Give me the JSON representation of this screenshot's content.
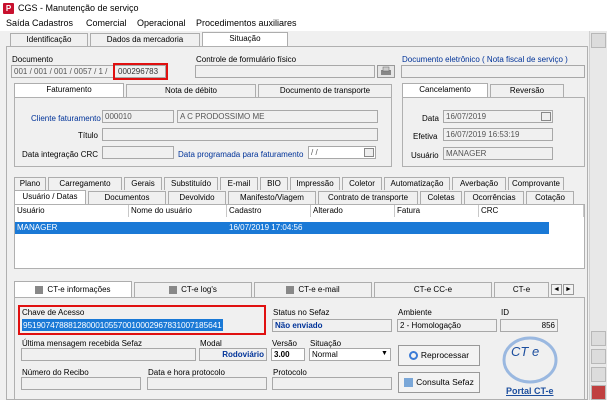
{
  "window": {
    "title": "CGS - Manutenção de serviço"
  },
  "menu": [
    "Saída",
    "Cadastros",
    "Comercial",
    "Operacional",
    "Procedimentos auxiliares"
  ],
  "top_tabs": [
    "Identificação",
    "Dados da mercadoria",
    "Situação"
  ],
  "documento": {
    "label": "Documento",
    "value": "001 / 001 / 001 / 0057 / 1 /",
    "number": "000296783"
  },
  "controle": {
    "label": "Controle de formulário físico"
  },
  "doc_eletronico": {
    "label": "Documento eletrônico ( Nota fiscal de serviço )"
  },
  "fat_tabs": [
    "Faturamento",
    "Nota de débito",
    "Documento de transporte"
  ],
  "cancel_tabs": [
    "Cancelamento",
    "Reversão"
  ],
  "fat": {
    "cliente_label": "Cliente faturamento",
    "cliente_code": "000010",
    "cliente_name": "A C PRODOSSIMO ME",
    "titulo_label": "Título",
    "integracao_label": "Data integração CRC",
    "programada_label": "Data programada para faturamento",
    "programada_value": "/ /"
  },
  "cancel": {
    "data_label": "Data",
    "data_value": "16/07/2019",
    "efetiva_label": "Efetiva",
    "efetiva_value": "16/07/2019 16:53:19",
    "usuario_label": "Usuário",
    "usuario_value": "MANAGER"
  },
  "sub_tabs_row1": [
    "Plano",
    "Carregamento",
    "Gerais",
    "Substituído",
    "E-mail",
    "BIO",
    "Impressão",
    "Coletor",
    "Automatização",
    "Averbação",
    "Comprovante"
  ],
  "sub_tabs_row2": [
    "Usuário / Datas",
    "Documentos",
    "Devolvido",
    "Manifesto/Viagem",
    "Contrato de transporte",
    "Coletas",
    "Ocorrências",
    "Cotação"
  ],
  "grid": {
    "headers": [
      "Usuário",
      "Nome do usuário",
      "Cadastro",
      "Alterado",
      "Fatura",
      "CRC"
    ],
    "row": [
      "MANAGER",
      "",
      "16/07/2019 17:04:56",
      "",
      "",
      ""
    ]
  },
  "cte_tabs": [
    "CT-e informações",
    "CT-e log's",
    "CT-e e-mail",
    "CT-e CC-e",
    "CT-e"
  ],
  "cte": {
    "chave_label": "Chave de Acesso",
    "chave_value": "95190747888128000105570010002967831007185641",
    "status_label": "Status no Sefaz",
    "status_value": "Não enviado",
    "ambiente_label": "Ambiente",
    "ambiente_value": "2 - Homologação",
    "id_label": "ID",
    "id_value": "856",
    "ultima_label": "Última mensagem recebida Sefaz",
    "modal_label": "Modal",
    "modal_value": "Rodoviário",
    "versao_label": "Versão",
    "versao_value": "3.00",
    "situacao_label": "Situação",
    "situacao_value": "Normal",
    "reprocessar_label": "Reprocessar",
    "consulta_label": "Consulta Sefaz",
    "recibo_label": "Número do Recibo",
    "protocolo_dt_label": "Data e hora protocolo",
    "protocolo_label": "Protocolo",
    "portal_label": "Portal CT-e",
    "logo_text": "CT e"
  },
  "colors": {
    "accent_red": "#e01010",
    "selection": "#1a79d6",
    "link": "#003399"
  }
}
